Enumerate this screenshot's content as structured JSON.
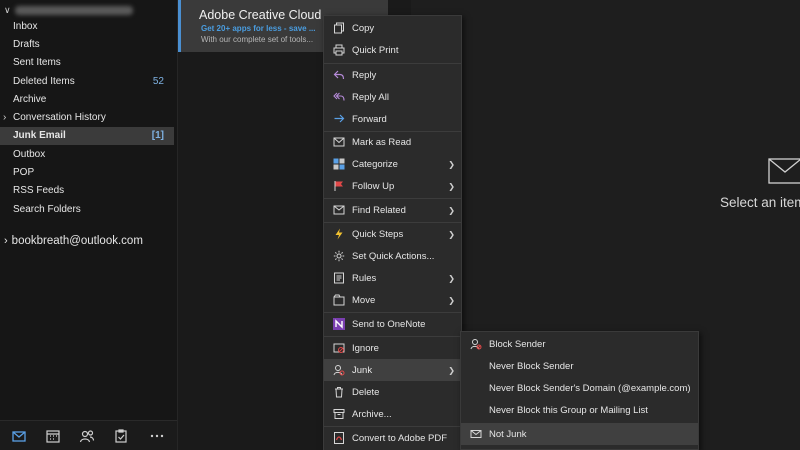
{
  "folder_pane": {
    "folders": [
      {
        "label": "Inbox",
        "count": ""
      },
      {
        "label": "Drafts",
        "count": ""
      },
      {
        "label": "Sent Items",
        "count": ""
      },
      {
        "label": "Deleted Items",
        "count": "52"
      },
      {
        "label": "Archive",
        "count": ""
      },
      {
        "label": "Conversation History",
        "count": ""
      },
      {
        "label": "Junk Email",
        "count": "[1]"
      },
      {
        "label": "Outbox",
        "count": ""
      },
      {
        "label": "POP",
        "count": ""
      },
      {
        "label": "RSS Feeds",
        "count": ""
      },
      {
        "label": "Search Folders",
        "count": ""
      }
    ],
    "second_account": "bookbreath@outlook.com"
  },
  "bottom_nav": [
    "mail-icon",
    "calendar-icon",
    "people-icon",
    "tasks-icon",
    "more-icon"
  ],
  "message": {
    "sender": "Adobe Creative Cloud",
    "subject": "Get 20+ apps for less - save ...",
    "preview": "With our complete set of tools..."
  },
  "reading_pane": {
    "text": "Select an item"
  },
  "context_menu": [
    {
      "label": "Copy",
      "icon": "copy-icon"
    },
    {
      "label": "Quick Print",
      "icon": "print-icon"
    },
    {
      "label": "Reply",
      "icon": "reply-icon"
    },
    {
      "label": "Reply All",
      "icon": "reply-all-icon"
    },
    {
      "label": "Forward",
      "icon": "forward-icon"
    },
    {
      "label": "Mark as Read",
      "icon": "mark-read-icon"
    },
    {
      "label": "Categorize",
      "icon": "categorize-icon"
    },
    {
      "label": "Follow Up",
      "icon": "flag-icon"
    },
    {
      "label": "Find Related",
      "icon": "find-icon"
    },
    {
      "label": "Quick Steps",
      "icon": "lightning-icon"
    },
    {
      "label": "Set Quick Actions...",
      "icon": "gear-icon"
    },
    {
      "label": "Rules",
      "icon": "rules-icon"
    },
    {
      "label": "Move",
      "icon": "move-icon"
    },
    {
      "label": "Send to OneNote",
      "icon": "onenote-icon"
    },
    {
      "label": "Ignore",
      "icon": "ignore-icon"
    },
    {
      "label": "Junk",
      "icon": "junk-icon"
    },
    {
      "label": "Delete",
      "icon": "delete-icon"
    },
    {
      "label": "Archive...",
      "icon": "archive-icon"
    },
    {
      "label": "Convert to Adobe PDF",
      "icon": "pdf-icon"
    }
  ],
  "junk_submenu": [
    {
      "label": "Block Sender"
    },
    {
      "label": "Never Block Sender"
    },
    {
      "label": "Never Block Sender's Domain (@example.com)"
    },
    {
      "label": "Never Block this Group or Mailing List"
    },
    {
      "label": "Not Junk"
    }
  ],
  "colors": {
    "accent": "#4a8fd1",
    "background": "#1f1f1f",
    "menu": "#2b2b2b"
  }
}
